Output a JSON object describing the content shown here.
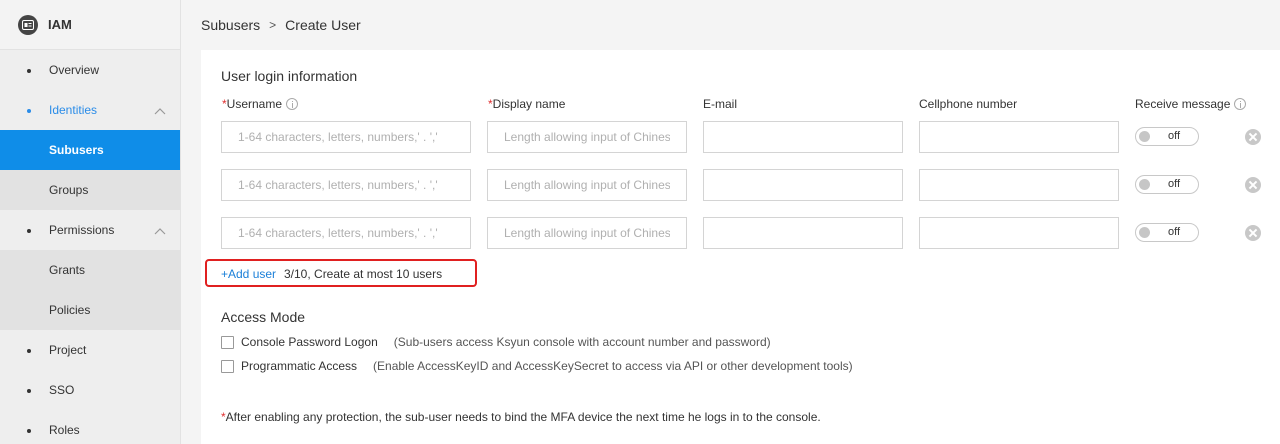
{
  "sidebar": {
    "title": "IAM",
    "items": [
      {
        "label": "Overview"
      },
      {
        "label": "Identities"
      },
      {
        "label": "Subusers"
      },
      {
        "label": "Groups"
      },
      {
        "label": "Permissions"
      },
      {
        "label": "Grants"
      },
      {
        "label": "Policies"
      },
      {
        "label": "Project"
      },
      {
        "label": "SSO"
      },
      {
        "label": "Roles"
      }
    ]
  },
  "breadcrumb": {
    "parent": "Subusers",
    "separator": ">",
    "current": "Create User"
  },
  "form": {
    "section_title": "User login information",
    "columns": {
      "username": {
        "required_mark": "*",
        "label": "Username"
      },
      "display_name": {
        "required_mark": "*",
        "label": "Display name"
      },
      "email": {
        "label": "E-mail"
      },
      "cellphone": {
        "label": "Cellphone number"
      },
      "receive_message": {
        "label": "Receive message"
      }
    },
    "placeholders": {
      "username": "1-64 characters, letters, numbers,' . ','",
      "display_name": "Length allowing input of Chinese"
    },
    "rows": [
      {
        "username": "",
        "display_name": "",
        "email": "",
        "cellphone": "",
        "receive_message": "off"
      },
      {
        "username": "",
        "display_name": "",
        "email": "",
        "cellphone": "",
        "receive_message": "off"
      },
      {
        "username": "",
        "display_name": "",
        "email": "",
        "cellphone": "",
        "receive_message": "off"
      }
    ],
    "add_user": {
      "link": "+Add user",
      "info": "3/10, Create at most 10 users"
    }
  },
  "access_mode": {
    "title": "Access Mode",
    "options": [
      {
        "label": "Console Password Logon",
        "description": "(Sub-users access Ksyun console with account number and password)",
        "checked": false
      },
      {
        "label": "Programmatic Access",
        "description": "(Enable AccessKeyID and AccessKeySecret to access via API or other development tools)",
        "checked": false
      }
    ]
  },
  "note": {
    "mark": "*",
    "text": "After enabling any protection, the sub-user needs to bind the MFA device the next time he logs in to the console."
  },
  "colors": {
    "accent": "#0f8de8",
    "link": "#1a7fd8",
    "required": "#e03030",
    "highlight": "#e02020"
  }
}
